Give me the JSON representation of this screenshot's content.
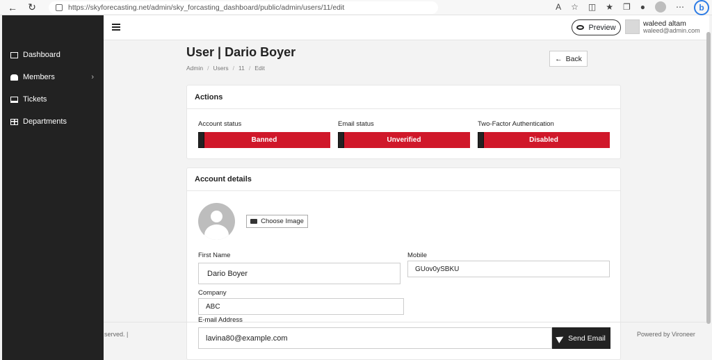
{
  "browser": {
    "url": "https://skyforecasting.net/admin/sky_forcasting_dashboard/public/admin/users/11/edit",
    "notification_count": "1"
  },
  "sidebar": {
    "items": [
      {
        "label": "Dashboard",
        "icon": "dashboard-icon"
      },
      {
        "label": "Members",
        "icon": "members-icon",
        "has_submenu": true
      },
      {
        "label": "Tickets",
        "icon": "tickets-icon"
      },
      {
        "label": "Departments",
        "icon": "departments-icon"
      }
    ]
  },
  "header": {
    "preview_label": "Preview",
    "user_name": "waleed altam",
    "user_email": "waleed@admin.com"
  },
  "page": {
    "title": "User | Dario Boyer",
    "breadcrumb": [
      "Admin",
      "Users",
      "11",
      "Edit"
    ],
    "back_label": "Back"
  },
  "actions": {
    "heading": "Actions",
    "statuses": [
      {
        "label": "Account status",
        "value": "Banned"
      },
      {
        "label": "Email status",
        "value": "Unverified"
      },
      {
        "label": "Two-Factor Authentication",
        "value": "Disabled"
      }
    ],
    "status_color": "#d0182a"
  },
  "account": {
    "heading": "Account details",
    "choose_image_label": "Choose Image",
    "first_name_label": "First Name",
    "first_name_value": "Dario Boyer",
    "mobile_label": "Mobile",
    "mobile_value": "GUov0ySBKU",
    "company_label": "Company",
    "company_value": "ABC",
    "email_label": "E-mail Address",
    "email_value": "lavina80@example.com",
    "send_email_label": "Send Email"
  },
  "footer": {
    "left": "served. |",
    "right": "Powered by Vironeer"
  }
}
